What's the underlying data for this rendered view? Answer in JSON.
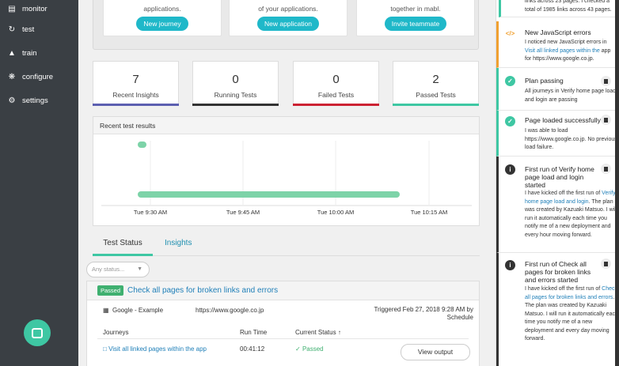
{
  "sidebar": {
    "items": [
      {
        "label": "monitor",
        "icon": "monitor-icon"
      },
      {
        "label": "test",
        "icon": "refresh-icon"
      },
      {
        "label": "train",
        "icon": "graduation-cap-icon"
      },
      {
        "label": "configure",
        "icon": "cogs-icon"
      },
      {
        "label": "settings",
        "icon": "gear-icon"
      }
    ]
  },
  "onboarding": {
    "cards": [
      {
        "text": "applications.",
        "button": "New journey"
      },
      {
        "text": "of your applications.",
        "button": "New application"
      },
      {
        "text": "together in mabl.",
        "button": "Invite teammate"
      }
    ]
  },
  "stats": [
    {
      "value": "7",
      "label": "Recent Insights",
      "color": "#5c5fb0"
    },
    {
      "value": "0",
      "label": "Running Tests",
      "color": "#333333"
    },
    {
      "value": "0",
      "label": "Failed Tests",
      "color": "#cc2233"
    },
    {
      "value": "2",
      "label": "Passed Tests",
      "color": "#3ec7a3"
    }
  ],
  "chart": {
    "title": "Recent test results",
    "x_labels": [
      "Tue 9:30 AM",
      "Tue 9:45 AM",
      "Tue 10:00 AM",
      "Tue 10:15 AM"
    ]
  },
  "chart_data": {
    "type": "scatter",
    "title": "Recent test results",
    "x_ticks": [
      "Tue 9:30 AM",
      "Tue 9:45 AM",
      "Tue 10:00 AM",
      "Tue 10:15 AM"
    ],
    "series": [
      {
        "values": [
          {
            "start": "9:28 AM",
            "end": "9:29 AM"
          },
          {
            "start": "9:28 AM",
            "end": "10:09 AM"
          }
        ]
      }
    ],
    "grid": true,
    "color": "#7dd3a8"
  },
  "tabs": {
    "items": [
      "Test Status",
      "Insights"
    ]
  },
  "filter": {
    "placeholder": "Any status..."
  },
  "result": {
    "badge": "Passed",
    "title": "Check all pages for broken links and errors",
    "app": "Google - Example",
    "url": "https://www.google.co.jp",
    "triggered": "Triggered Feb 27, 2018 9:28 AM by Schedule",
    "headers": {
      "journeys": "Journeys",
      "run_time": "Run Time",
      "status": "Current Status"
    },
    "row": {
      "journey": "Visit all linked pages within the app",
      "run_time": "00:41:12",
      "status": "Passed"
    },
    "view_button": "View output"
  },
  "feed": {
    "top_text": "links across 23 pages. I checked a total of 1985 links across 43 pages.",
    "items": [
      {
        "icon": "code-icon",
        "color": "#f0a030",
        "title": "New JavaScript errors",
        "body_before": "I noticed new JavaScript errors in ",
        "body_link": "Visit all linked pages within the",
        "body_after": " app for https://www.google.co.jp."
      },
      {
        "icon": "check-circle-icon",
        "color": "#3ec7a3",
        "title": "Plan passing",
        "body": "All journeys in Verify home page load and login are passing"
      },
      {
        "icon": "check-circle-icon",
        "color": "#3ec7a3",
        "title": "Page loaded successfully",
        "body": "I was able to load https://www.google.co.jp. No previous load failure."
      },
      {
        "icon": "info-circle-icon",
        "color": "#333333",
        "title": "First run of Verify home page load and login started",
        "body_before": "I have kicked off the first run of ",
        "body_link": "Verify home page load and login",
        "body_after": ". The plan was created by Kazuaki Matsuo. I will run it automatically each time you notify me of a new deployment and every hour moving forward."
      },
      {
        "icon": "info-circle-icon",
        "color": "#333333",
        "title": "First run of Check all pages for broken links and errors started",
        "body_before": "I have kicked off the first run of ",
        "body_link": "Check all pages for broken links and errors",
        "body_after": ". The plan was created by Kazuaki Matsuo. I will run it automatically each time you notify me of a new deployment and every day moving forward."
      }
    ]
  }
}
